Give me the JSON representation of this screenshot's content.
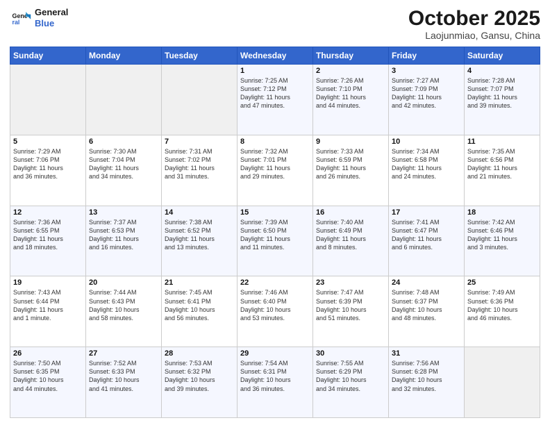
{
  "header": {
    "logo_line1": "General",
    "logo_line2": "Blue",
    "month": "October 2025",
    "location": "Laojunmiao, Gansu, China"
  },
  "weekdays": [
    "Sunday",
    "Monday",
    "Tuesday",
    "Wednesday",
    "Thursday",
    "Friday",
    "Saturday"
  ],
  "weeks": [
    [
      {
        "day": "",
        "info": ""
      },
      {
        "day": "",
        "info": ""
      },
      {
        "day": "",
        "info": ""
      },
      {
        "day": "1",
        "info": "Sunrise: 7:25 AM\nSunset: 7:12 PM\nDaylight: 11 hours\nand 47 minutes."
      },
      {
        "day": "2",
        "info": "Sunrise: 7:26 AM\nSunset: 7:10 PM\nDaylight: 11 hours\nand 44 minutes."
      },
      {
        "day": "3",
        "info": "Sunrise: 7:27 AM\nSunset: 7:09 PM\nDaylight: 11 hours\nand 42 minutes."
      },
      {
        "day": "4",
        "info": "Sunrise: 7:28 AM\nSunset: 7:07 PM\nDaylight: 11 hours\nand 39 minutes."
      }
    ],
    [
      {
        "day": "5",
        "info": "Sunrise: 7:29 AM\nSunset: 7:06 PM\nDaylight: 11 hours\nand 36 minutes."
      },
      {
        "day": "6",
        "info": "Sunrise: 7:30 AM\nSunset: 7:04 PM\nDaylight: 11 hours\nand 34 minutes."
      },
      {
        "day": "7",
        "info": "Sunrise: 7:31 AM\nSunset: 7:02 PM\nDaylight: 11 hours\nand 31 minutes."
      },
      {
        "day": "8",
        "info": "Sunrise: 7:32 AM\nSunset: 7:01 PM\nDaylight: 11 hours\nand 29 minutes."
      },
      {
        "day": "9",
        "info": "Sunrise: 7:33 AM\nSunset: 6:59 PM\nDaylight: 11 hours\nand 26 minutes."
      },
      {
        "day": "10",
        "info": "Sunrise: 7:34 AM\nSunset: 6:58 PM\nDaylight: 11 hours\nand 24 minutes."
      },
      {
        "day": "11",
        "info": "Sunrise: 7:35 AM\nSunset: 6:56 PM\nDaylight: 11 hours\nand 21 minutes."
      }
    ],
    [
      {
        "day": "12",
        "info": "Sunrise: 7:36 AM\nSunset: 6:55 PM\nDaylight: 11 hours\nand 18 minutes."
      },
      {
        "day": "13",
        "info": "Sunrise: 7:37 AM\nSunset: 6:53 PM\nDaylight: 11 hours\nand 16 minutes."
      },
      {
        "day": "14",
        "info": "Sunrise: 7:38 AM\nSunset: 6:52 PM\nDaylight: 11 hours\nand 13 minutes."
      },
      {
        "day": "15",
        "info": "Sunrise: 7:39 AM\nSunset: 6:50 PM\nDaylight: 11 hours\nand 11 minutes."
      },
      {
        "day": "16",
        "info": "Sunrise: 7:40 AM\nSunset: 6:49 PM\nDaylight: 11 hours\nand 8 minutes."
      },
      {
        "day": "17",
        "info": "Sunrise: 7:41 AM\nSunset: 6:47 PM\nDaylight: 11 hours\nand 6 minutes."
      },
      {
        "day": "18",
        "info": "Sunrise: 7:42 AM\nSunset: 6:46 PM\nDaylight: 11 hours\nand 3 minutes."
      }
    ],
    [
      {
        "day": "19",
        "info": "Sunrise: 7:43 AM\nSunset: 6:44 PM\nDaylight: 11 hours\nand 1 minute."
      },
      {
        "day": "20",
        "info": "Sunrise: 7:44 AM\nSunset: 6:43 PM\nDaylight: 10 hours\nand 58 minutes."
      },
      {
        "day": "21",
        "info": "Sunrise: 7:45 AM\nSunset: 6:41 PM\nDaylight: 10 hours\nand 56 minutes."
      },
      {
        "day": "22",
        "info": "Sunrise: 7:46 AM\nSunset: 6:40 PM\nDaylight: 10 hours\nand 53 minutes."
      },
      {
        "day": "23",
        "info": "Sunrise: 7:47 AM\nSunset: 6:39 PM\nDaylight: 10 hours\nand 51 minutes."
      },
      {
        "day": "24",
        "info": "Sunrise: 7:48 AM\nSunset: 6:37 PM\nDaylight: 10 hours\nand 48 minutes."
      },
      {
        "day": "25",
        "info": "Sunrise: 7:49 AM\nSunset: 6:36 PM\nDaylight: 10 hours\nand 46 minutes."
      }
    ],
    [
      {
        "day": "26",
        "info": "Sunrise: 7:50 AM\nSunset: 6:35 PM\nDaylight: 10 hours\nand 44 minutes."
      },
      {
        "day": "27",
        "info": "Sunrise: 7:52 AM\nSunset: 6:33 PM\nDaylight: 10 hours\nand 41 minutes."
      },
      {
        "day": "28",
        "info": "Sunrise: 7:53 AM\nSunset: 6:32 PM\nDaylight: 10 hours\nand 39 minutes."
      },
      {
        "day": "29",
        "info": "Sunrise: 7:54 AM\nSunset: 6:31 PM\nDaylight: 10 hours\nand 36 minutes."
      },
      {
        "day": "30",
        "info": "Sunrise: 7:55 AM\nSunset: 6:29 PM\nDaylight: 10 hours\nand 34 minutes."
      },
      {
        "day": "31",
        "info": "Sunrise: 7:56 AM\nSunset: 6:28 PM\nDaylight: 10 hours\nand 32 minutes."
      },
      {
        "day": "",
        "info": ""
      }
    ]
  ]
}
